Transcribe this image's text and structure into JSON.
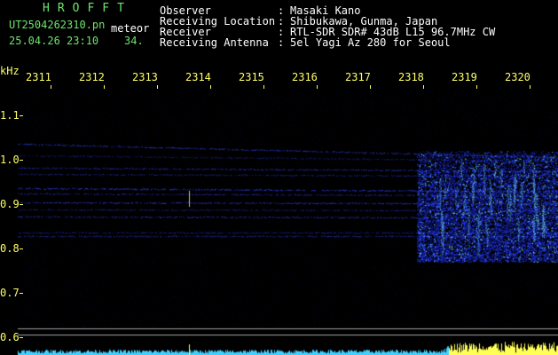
{
  "header": {
    "brand": "HROFFT",
    "filename": "UT2504262310.pn",
    "type": "meteor",
    "timestamp": "25.04.26 23:10",
    "counter": "34."
  },
  "info": {
    "observer_label": "Observer",
    "observer_value": "Masaki Kano",
    "location_label": "Receiving Location",
    "location_value": "Shibukawa, Gunma, Japan",
    "receiver_label": "Receiver",
    "receiver_value": "RTL-SDR SDR# 43dB L15 96.7MHz CW",
    "antenna_label": "Receiving Antenna",
    "antenna_value": "5el Yagi Az 280 for Seoul",
    "separator": ":"
  },
  "axis": {
    "freq_unit": "kHz",
    "freq_ticks": [
      "1.1",
      "1.0",
      "0.9",
      "0.8",
      "0.7",
      "0.6"
    ],
    "time_ticks": [
      "2311",
      "2312",
      "2313",
      "2314",
      "2315",
      "2316",
      "2317",
      "2318",
      "2319",
      "2320"
    ]
  },
  "colors": {
    "background": "#000000",
    "axis_text": "#ffff66",
    "title_green": "#6ee46e",
    "signal_blue": "#2a3cff",
    "signal_cyan": "#6ff0ff"
  }
}
